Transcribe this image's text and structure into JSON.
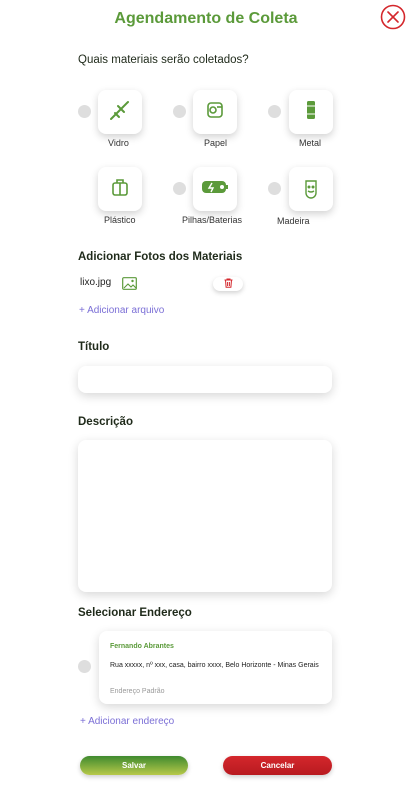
{
  "header": {
    "title": "Agendamento de Coleta",
    "close_icon": "close-circle-icon"
  },
  "materials": {
    "question": "Quais materiais serão coletados?",
    "items": [
      {
        "label": "Vidro",
        "icon": "glass-bottle-icon"
      },
      {
        "label": "Papel",
        "icon": "paper-roll-icon"
      },
      {
        "label": "Metal",
        "icon": "metal-can-icon"
      },
      {
        "label": "Plástico",
        "icon": "plastic-bag-icon"
      },
      {
        "label": "Pilhas/Baterias",
        "icon": "battery-icon"
      },
      {
        "label": "Madeira",
        "icon": "wood-icon"
      }
    ]
  },
  "photos": {
    "heading": "Adicionar Fotos dos Materiais",
    "file_name": "lixo.jpg",
    "add_file": "+ Adicionar arquivo"
  },
  "form": {
    "title_label": "Título",
    "title_value": "",
    "description_label": "Descrição",
    "description_value": ""
  },
  "address": {
    "heading": "Selecionar Endereço",
    "name": "Fernando Abrantes",
    "line": "Rua xxxxx, nº xxx, casa, bairro xxxx, Belo Horizonte - Minas Gerais",
    "tag": "Endereço Padrão",
    "add_address": "+ Adicionar endereço"
  },
  "actions": {
    "save": "Salvar",
    "cancel": "Cancelar"
  },
  "colors": {
    "accent_green": "#5b9a3a",
    "danger_red": "#d4272c",
    "link_purple": "#7b6fd6"
  }
}
